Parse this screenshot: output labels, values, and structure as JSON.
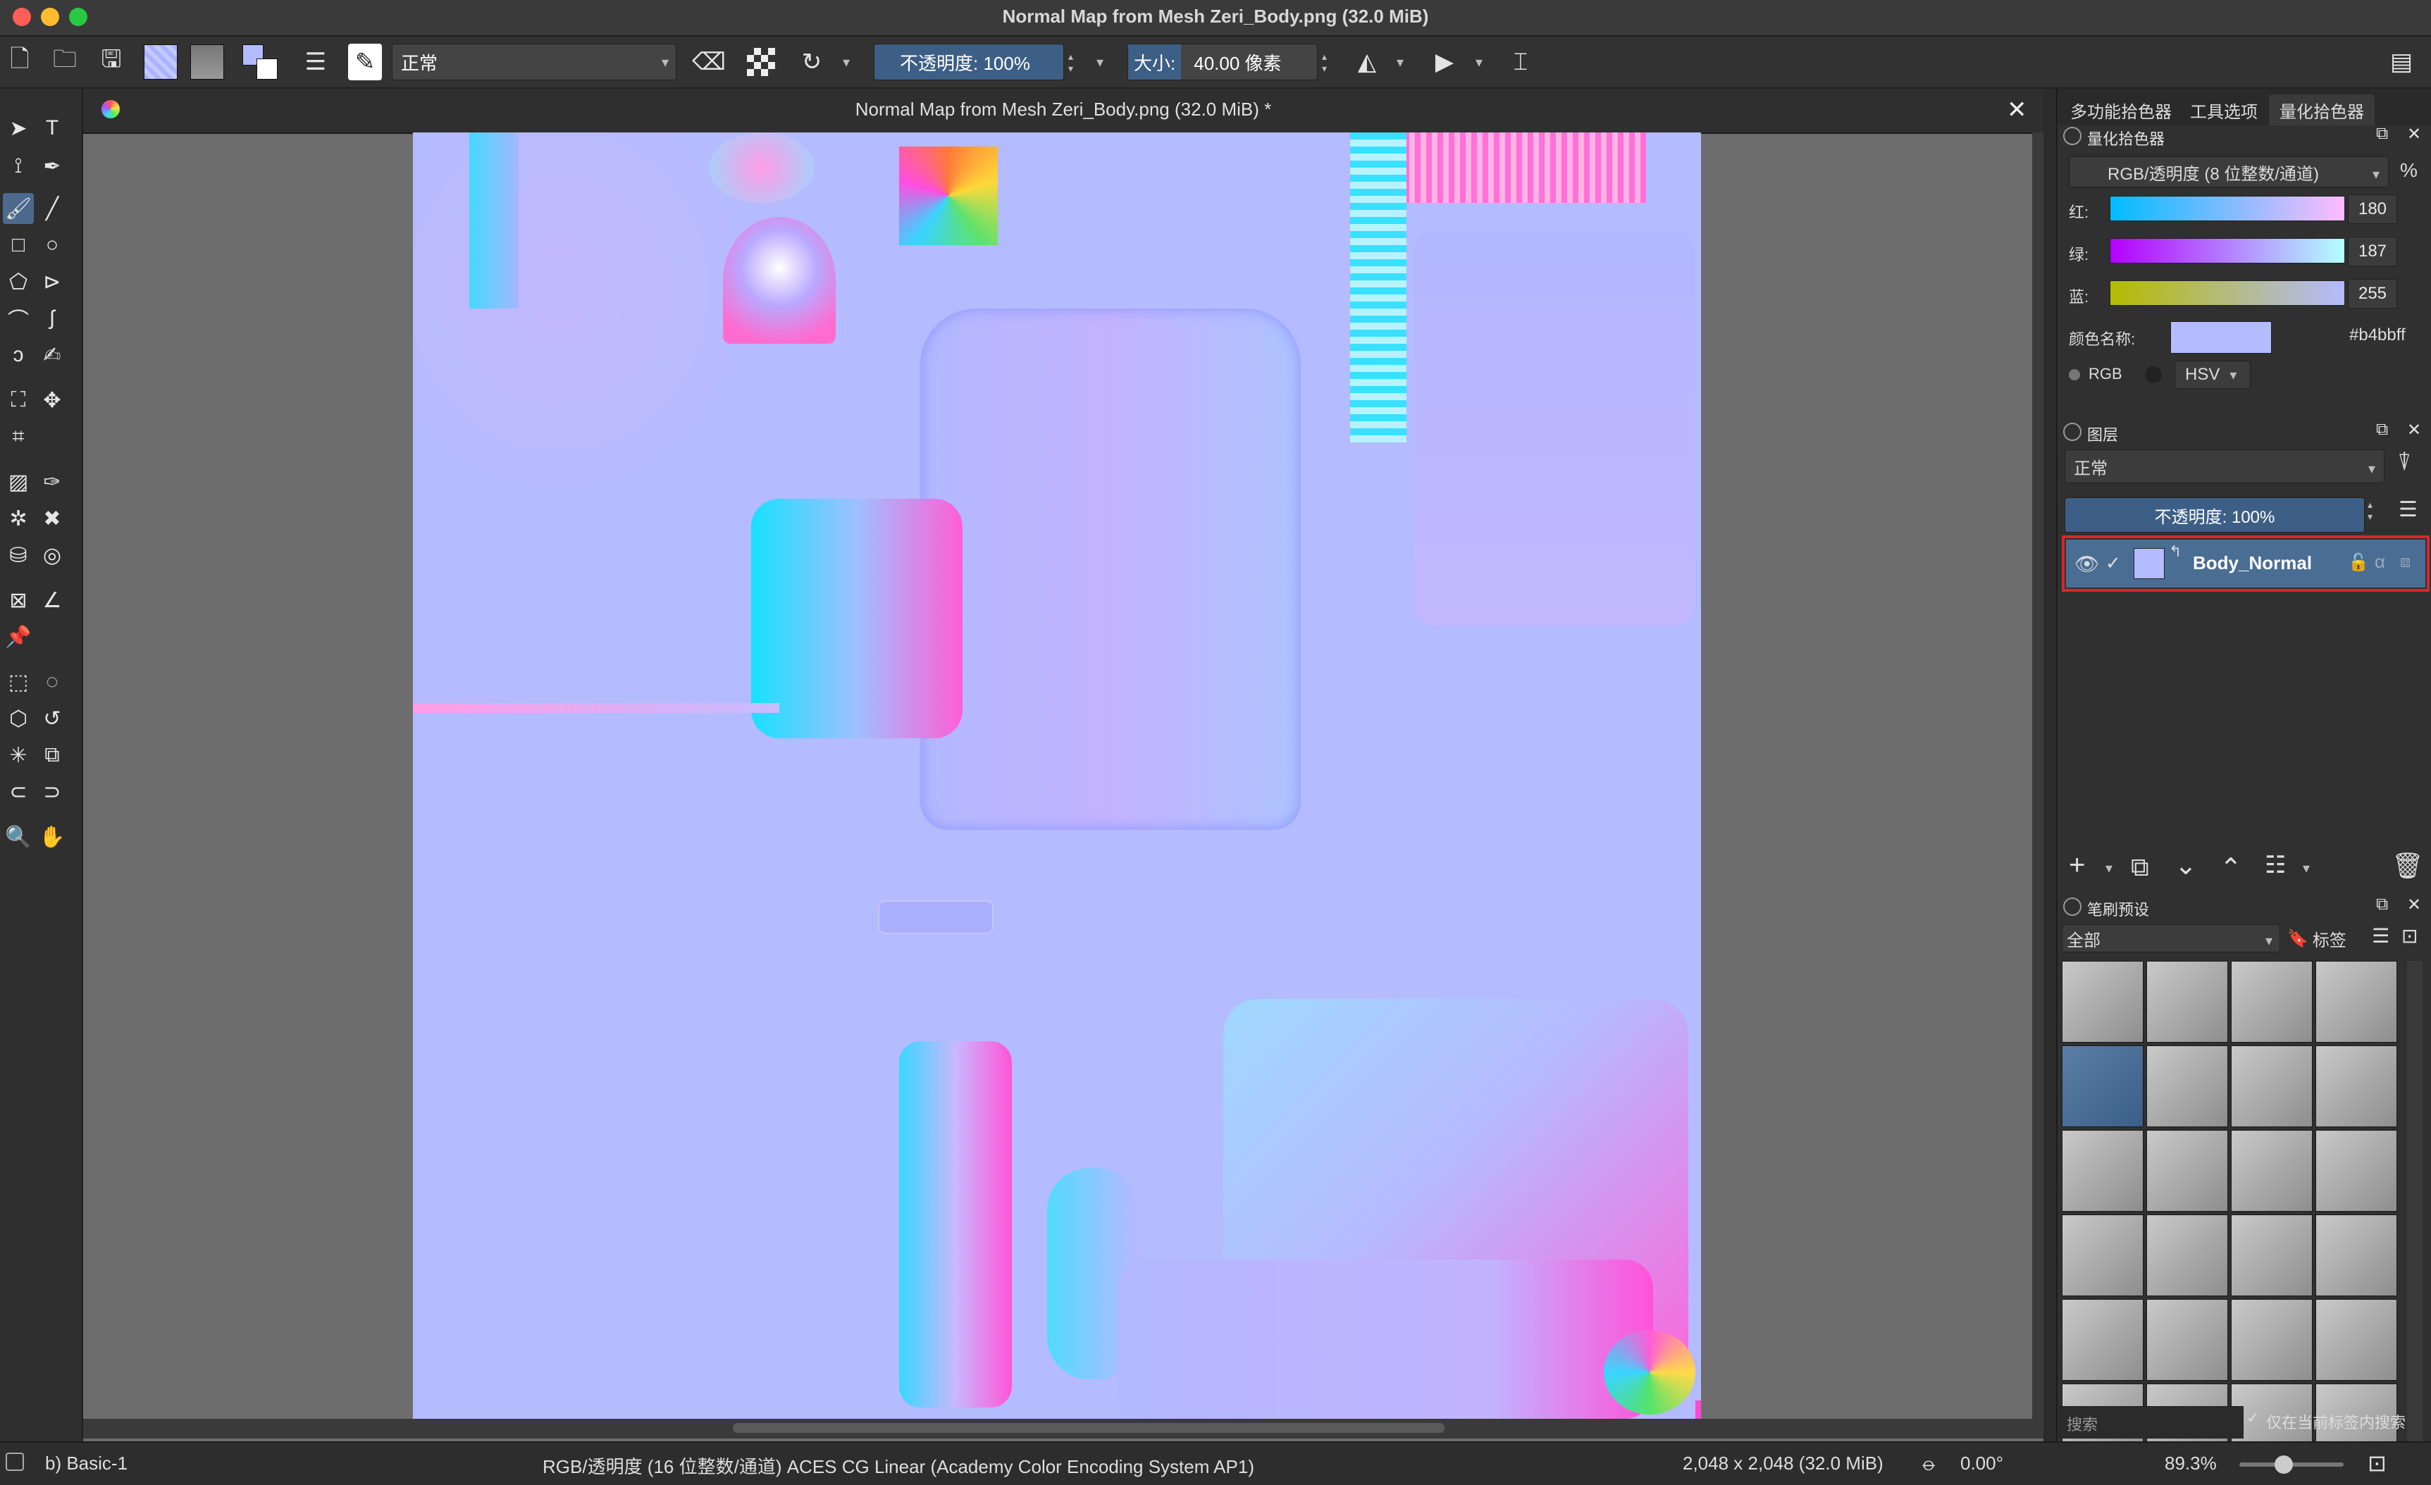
{
  "window": {
    "title": "Normal Map from Mesh Zeri_Body.png (32.0 MiB)",
    "traffic_lights": [
      "#ff5f57",
      "#febc2e",
      "#28c840"
    ]
  },
  "toolbar": {
    "blend_mode": "正常",
    "opacity": "不透明度:  100%",
    "size_label": "大小:",
    "size_value": "40.00 像素",
    "icons": [
      "new-doc-icon",
      "open-icon",
      "save-icon",
      "pattern-icon",
      "gradient-icon",
      "fg-bg-colors-icon",
      "presets-icon",
      "brush-editor-icon",
      "eraser-icon",
      "alpha-lock-icon",
      "reload-icon",
      "mirror-horizontal-icon",
      "mirror-vertical-icon",
      "crop-wrap-icon",
      "workspace-icon"
    ]
  },
  "document": {
    "tab_title": "Normal Map from Mesh Zeri_Body.png (32.0 MiB) *",
    "close_symbol": "✕"
  },
  "docker_tabs": [
    "多功能拾色器",
    "工具选项",
    "量化拾色器"
  ],
  "color_selector": {
    "header": "量化拾色器",
    "model": "RGB/透明度 (8 位整数/通道)",
    "percent_symbol": "%",
    "channels": [
      {
        "label": "红:",
        "value": "180"
      },
      {
        "label": "绿:",
        "value": "187"
      },
      {
        "label": "蓝:",
        "value": "255"
      }
    ],
    "color_name_label": "颜色名称:",
    "hex": "#b4bbff",
    "mode_rgb": "RGB",
    "mode_hsv": "HSV",
    "swatch_color": "#b4bbff"
  },
  "layers": {
    "header": "图层",
    "blend_mode": "正常",
    "opacity": "不透明度:  100%",
    "items": [
      {
        "name": "Body_Normal",
        "visible": true,
        "selected": true
      }
    ],
    "actions": [
      "add-layer-icon",
      "duplicate-layer-icon",
      "move-down-icon",
      "move-up-icon",
      "layer-properties-icon",
      "delete-layer-icon"
    ]
  },
  "brush_presets": {
    "header": "笔刷预设",
    "filter": "全部",
    "tag_button": "标签",
    "search_placeholder": "搜索",
    "only_current_tag": "仅在当前标签内搜索"
  },
  "statusbar": {
    "brush_name": "b) Basic-1",
    "color_space": "RGB/透明度 (16 位整数/通道)  ACES CG Linear (Academy Color Encoding System AP1)",
    "dimensions": "2,048 x 2,048 (32.0 MiB)",
    "rotation": "0.00°",
    "zoom": "89.3%"
  }
}
